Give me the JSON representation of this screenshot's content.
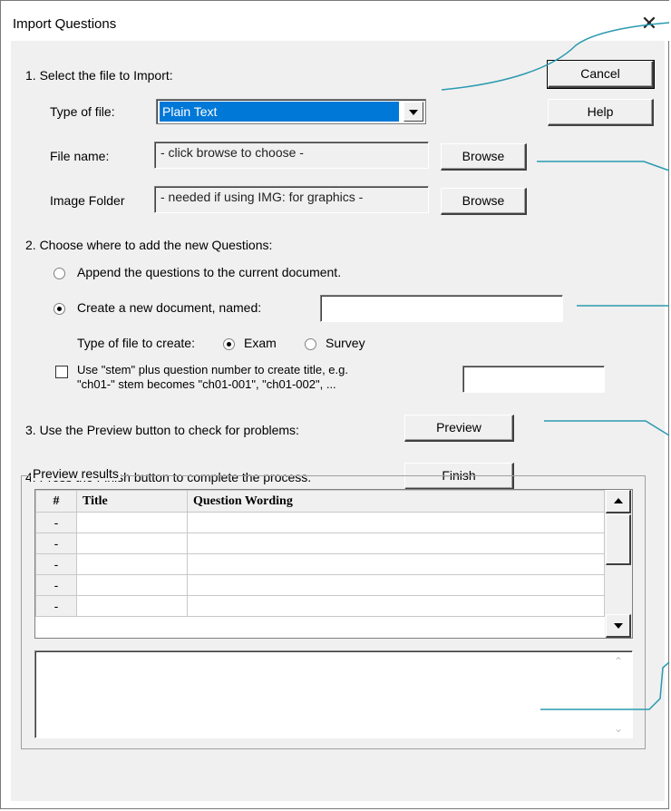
{
  "window": {
    "title": "Import Questions",
    "close_glyph": "✕"
  },
  "step1": {
    "heading": "1. Select the file to Import:",
    "type_label": "Type of file:",
    "type_value": "Plain Text",
    "filename_label": "File name:",
    "filename_value": "- click browse to choose -",
    "imagefolder_label": "Image Folder",
    "imagefolder_value": "- needed if using IMG: for graphics -",
    "browse_label": "Browse"
  },
  "buttons": {
    "cancel": "Cancel",
    "help": "Help",
    "preview": "Preview",
    "finish": "Finish"
  },
  "step2": {
    "heading": "2. Choose where to add the new Questions:",
    "append_label": "Append the questions to the current document.",
    "create_label": "Create a new document, named:",
    "create_value": "",
    "filetype_label": "Type of file to create:",
    "exam_label": "Exam",
    "survey_label": "Survey",
    "stem_line1": "Use \"stem\" plus question number to create title,  e.g.",
    "stem_line2": "\"ch01-\" stem becomes \"ch01-001\",  \"ch01-002\",  ...",
    "stem_value": ""
  },
  "step3": {
    "text": "3. Use the Preview button to check for problems:"
  },
  "step4": {
    "text": "4. Press the Finish button to complete the process."
  },
  "preview": {
    "group_label": "Preview results",
    "columns": [
      "#",
      "Title",
      "Question Wording"
    ],
    "rows": [
      {
        "num": "-",
        "title": "",
        "wording": ""
      },
      {
        "num": "-",
        "title": "",
        "wording": ""
      },
      {
        "num": "-",
        "title": "",
        "wording": ""
      },
      {
        "num": "-",
        "title": "",
        "wording": ""
      },
      {
        "num": "-",
        "title": "",
        "wording": ""
      }
    ],
    "memo_text": ""
  },
  "colors": {
    "selection": "#0078d7",
    "callout": "#2a9ab0",
    "face": "#f0f0f0"
  }
}
